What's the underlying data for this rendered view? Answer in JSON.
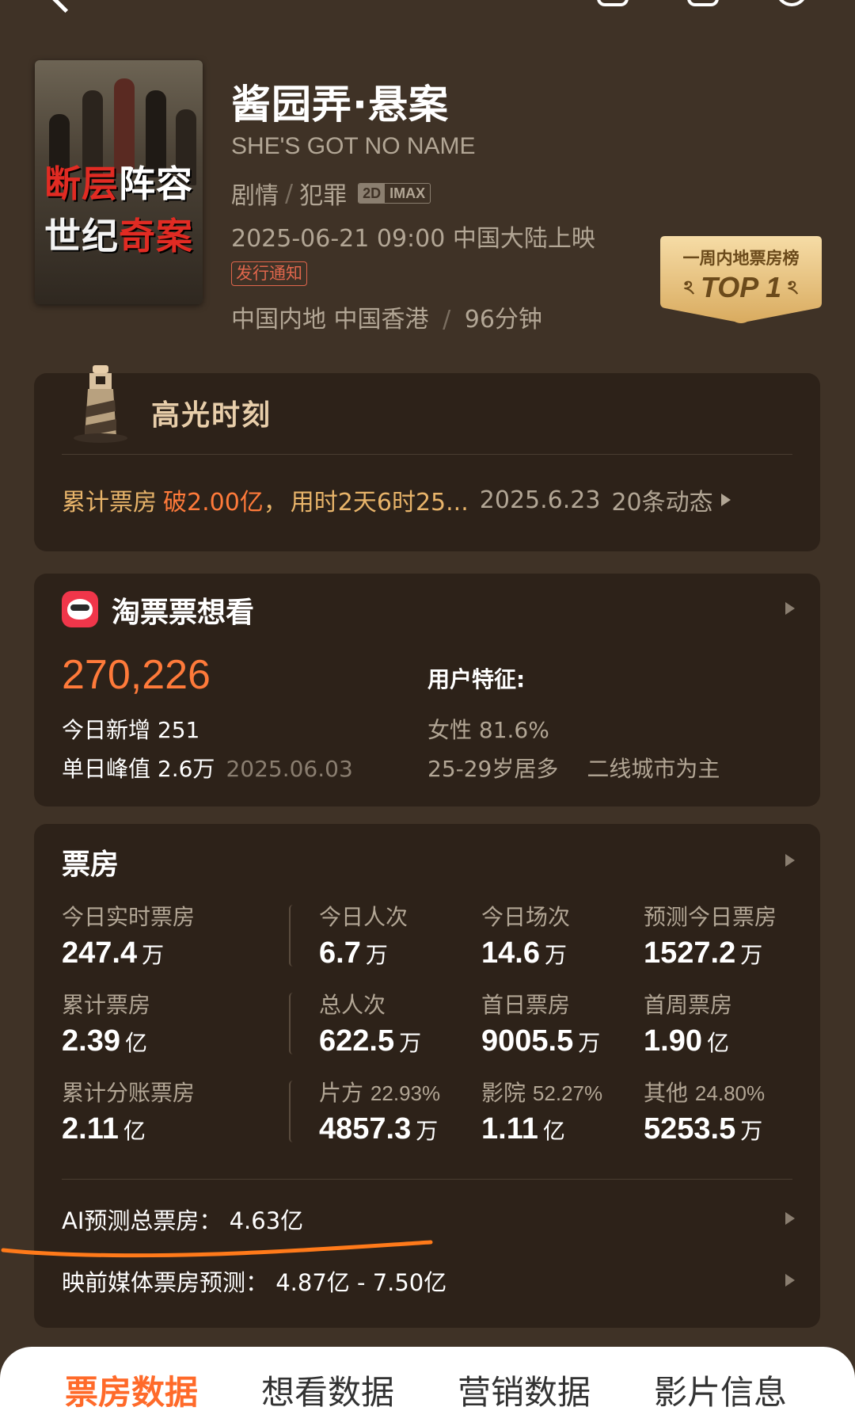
{
  "movie": {
    "title": "酱园弄·悬案",
    "title_en": "SHE'S GOT NO NAME",
    "genres": [
      "剧情",
      "犯罪"
    ],
    "formats": [
      "2D",
      "IMAX"
    ],
    "release": "2025-06-21 09:00 中国大陆上映",
    "notice_tag": "发行通知",
    "regions": "中国内地 中国香港",
    "duration": "96分钟",
    "poster_line1_a": "断层",
    "poster_line1_b": "阵容",
    "poster_line2_a": "世纪",
    "poster_line2_b": "奇案"
  },
  "rank_badge": {
    "title": "一周内地票房榜",
    "value": "TOP 1"
  },
  "highlight": {
    "title": "高光时刻",
    "label": "累计票房",
    "value": "破2.00亿",
    "separator": "，",
    "detail": "用时2天6时25...",
    "date": "2025.6.23",
    "count": "20条动态"
  },
  "want": {
    "title": "淘票票想看",
    "total": "270,226",
    "today_new": "今日新增 251",
    "peak": "单日峰值 2.6万",
    "peak_date": "2025.06.03",
    "user_title": "用户特征:",
    "female": "女性 81.6%",
    "age": "25-29岁居多",
    "city": "二线城市为主"
  },
  "box_office": {
    "title": "票房",
    "rows": [
      [
        {
          "label": "今日实时票房",
          "value": "247.4",
          "unit": "万"
        },
        {
          "label": "今日人次",
          "value": "6.7",
          "unit": "万"
        },
        {
          "label": "今日场次",
          "value": "14.6",
          "unit": "万"
        },
        {
          "label": "预测今日票房",
          "value": "1527.2",
          "unit": "万"
        }
      ],
      [
        {
          "label": "累计票房",
          "value": "2.39",
          "unit": "亿"
        },
        {
          "label": "总人次",
          "value": "622.5",
          "unit": "万"
        },
        {
          "label": "首日票房",
          "value": "9005.5",
          "unit": "万"
        },
        {
          "label": "首周票房",
          "value": "1.90",
          "unit": "亿"
        }
      ],
      [
        {
          "label": "累计分账票房",
          "pct": "",
          "value": "2.11",
          "unit": "亿"
        },
        {
          "label": "片方",
          "pct": "22.93%",
          "value": "4857.3",
          "unit": "万"
        },
        {
          "label": "影院",
          "pct": "52.27%",
          "value": "1.11",
          "unit": "亿"
        },
        {
          "label": "其他",
          "pct": "24.80%",
          "value": "5253.5",
          "unit": "万"
        }
      ]
    ],
    "ai_forecast": "AI预测总票房：  4.63亿",
    "media_forecast": "映前媒体票房预测：  4.87亿 - 7.50亿"
  },
  "tabs": [
    "票房数据",
    "想看数据",
    "营销数据",
    "影片信息"
  ],
  "active_tab": "票房数据",
  "colors": {
    "background": "#3f3226",
    "card": "#2d2219",
    "accent": "#ff7a3a",
    "gold": "#e8b46a"
  }
}
